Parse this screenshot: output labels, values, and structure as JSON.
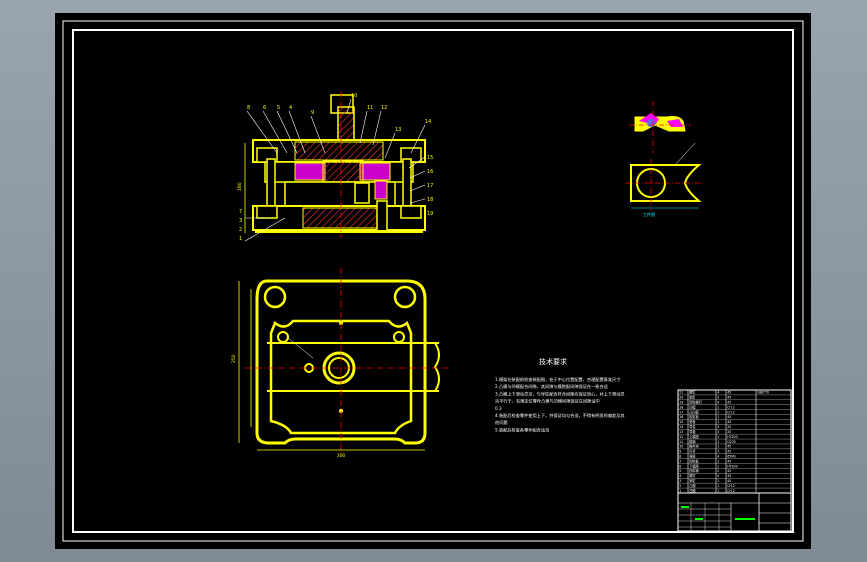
{
  "drawing": {
    "technical_requirements": {
      "title": "技术要求",
      "lines": [
        "1.模架在装配前检查装配图，处于中心位置配置，合理配置基准尺寸",
        "2.凸模与凹模配合间隙，其间隙与模腔配间隙保证在一致合适",
        "3.凸模上下滑动灵活，与导柱配合符合间隙应保证同心，并上下滑动灵",
        "  活平行于，有限定位零件凸模与凹模间隙保证在间隙适中",
        "0.3",
        "4.装配后检查零件使用上下，并保证均匀合适，不得有明显的偏差及其",
        "  他问题",
        "5.装配后检查各零件配合适当"
      ]
    },
    "section_view": {
      "part_numbers_top": [
        "8",
        "6",
        "5",
        "4",
        "9",
        "10",
        "11",
        "12",
        "13",
        "14"
      ],
      "part_numbers_right": [
        "15",
        "16",
        "17",
        "18",
        "19"
      ],
      "part_numbers_left": [
        "7",
        "3",
        "2",
        "1"
      ],
      "height_dim": "180"
    },
    "plan_view": {
      "width_dim": "300",
      "height_dim": "250"
    },
    "part_view": {
      "label": "工件图"
    },
    "bom": {
      "rows": [
        [
          "21",
          "螺钉",
          "4",
          "45",
          "GB/T70"
        ],
        [
          "20",
          "销钉",
          "2",
          "45",
          ""
        ],
        [
          "19",
          "卸料螺钉",
          "4",
          "45",
          ""
        ],
        [
          "18",
          "凹模",
          "1",
          "Cr12",
          ""
        ],
        [
          "17",
          "凸凹模",
          "1",
          "Cr12",
          ""
        ],
        [
          "16",
          "固定板",
          "1",
          "45",
          ""
        ],
        [
          "15",
          "垫板",
          "1",
          "45",
          ""
        ],
        [
          "14",
          "导柱",
          "2",
          "20",
          ""
        ],
        [
          "13",
          "导套",
          "2",
          "20",
          ""
        ],
        [
          "12",
          "上模座",
          "1",
          "HT200",
          ""
        ],
        [
          "11",
          "模柄",
          "1",
          "Q235",
          ""
        ],
        [
          "10",
          "推件块",
          "1",
          "45",
          ""
        ],
        [
          "9",
          "打杆",
          "1",
          "45",
          ""
        ],
        [
          "8",
          "弹簧",
          "4",
          "65Mn",
          ""
        ],
        [
          "7",
          "卸料板",
          "1",
          "45",
          ""
        ],
        [
          "6",
          "下模座",
          "1",
          "HT200",
          ""
        ],
        [
          "5",
          "挡料销",
          "2",
          "45",
          ""
        ],
        [
          "4",
          "螺钉",
          "4",
          "45",
          ""
        ],
        [
          "3",
          "销钉",
          "2",
          "45",
          ""
        ],
        [
          "2",
          "凸模",
          "1",
          "Cr12",
          ""
        ],
        [
          "1",
          "凹模",
          "1",
          "Cr12",
          ""
        ]
      ]
    },
    "colors": {
      "frame": "#ffffff",
      "outline": "#ffff00",
      "hatch": "#ff00ff",
      "center": "#ff0000",
      "dim": "#00ffff",
      "part": "#ffff00"
    }
  }
}
